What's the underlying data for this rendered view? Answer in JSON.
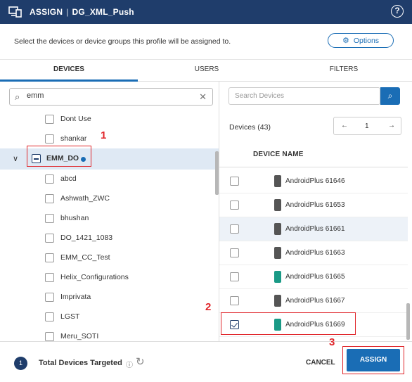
{
  "header": {
    "app_label": "ASSIGN",
    "profile_name": "DG_XML_Push",
    "help_symbol": "?"
  },
  "subtitle": "Select the devices or device groups this profile will be assigned to.",
  "options_button": "Options",
  "tabs": [
    {
      "label": "DEVICES",
      "active": true
    },
    {
      "label": "USERS",
      "active": false
    },
    {
      "label": "FILTERS",
      "active": false
    }
  ],
  "left_search": {
    "value": "emm"
  },
  "tree": {
    "top_items": [
      "Dont Use",
      "shankar"
    ],
    "group": {
      "label": "EMM_DO",
      "expanded": true,
      "state": "partial"
    },
    "children": [
      "abcd",
      "Ashwath_ZWC",
      "bhushan",
      "DO_1421_1083",
      "EMM_CC_Test",
      "Helix_Configurations",
      "Imprivata",
      "LGST",
      "Meru_SOTI"
    ]
  },
  "device_search": {
    "placeholder": "Search Devices"
  },
  "devices": {
    "count_label": "Devices (43)",
    "page": "1",
    "column_header": "DEVICE NAME",
    "rows": [
      {
        "name": "AndroidPlus 61646",
        "checked": false,
        "icon": "phone-dark-icon"
      },
      {
        "name": "AndroidPlus 61653",
        "checked": false,
        "icon": "phone-dark-icon"
      },
      {
        "name": "AndroidPlus 61661",
        "checked": false,
        "icon": "phone-dark-icon"
      },
      {
        "name": "AndroidPlus 61663",
        "checked": false,
        "icon": "phone-dark-icon"
      },
      {
        "name": "AndroidPlus 61665",
        "checked": false,
        "icon": "phone-green-icon"
      },
      {
        "name": "AndroidPlus 61667",
        "checked": false,
        "icon": "phone-dark-icon"
      },
      {
        "name": "AndroidPlus 61669",
        "checked": true,
        "icon": "phone-green-icon"
      }
    ]
  },
  "footer": {
    "targeted_count": "1",
    "targeted_label": "Total Devices Targeted",
    "cancel_label": "CANCEL",
    "assign_label": "ASSIGN"
  },
  "annotations": {
    "marker_1": "1",
    "marker_2": "2",
    "marker_3": "3"
  },
  "colors": {
    "header_bg": "#1f3d6b",
    "accent": "#1a6db5",
    "highlight": "#e0262b"
  }
}
